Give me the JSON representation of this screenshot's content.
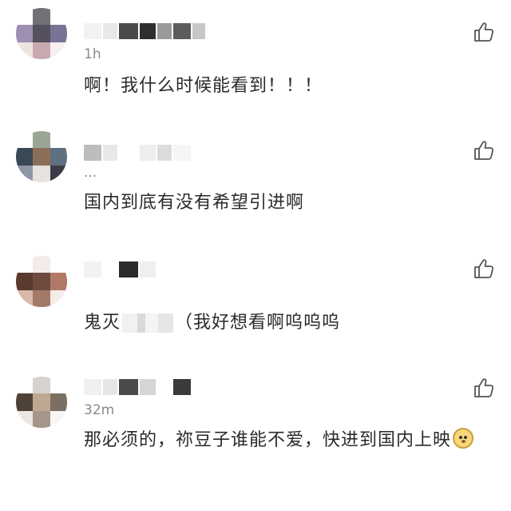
{
  "comments": [
    {
      "time": "1h",
      "text": "啊！我什么时候能看到！！！",
      "avatar_colors": [
        "#ffffff",
        "#6f7177",
        "#ffffff",
        "#9c8fb2",
        "#55505e",
        "#7a7294",
        "#efe3e0",
        "#c9a9b0",
        "#f6efef"
      ],
      "username_blocks": [
        "#f2f2f2",
        "#e9e9e9",
        "#4b4b4b",
        "#2e2e2e",
        "#9a9a9a",
        "#5c5c5c",
        "#c7c7c7"
      ]
    },
    {
      "time": "...",
      "text": "国内到底有没有希望引进啊",
      "avatar_colors": [
        "#ffffff",
        "#9ba596",
        "#ffffff",
        "#3b4955",
        "#8c6e59",
        "#5f7080",
        "#8e96a4",
        "#e6e2e0",
        "#3d3c46"
      ],
      "username_blocks": [
        "#bdbdbd",
        "#e8e8e8",
        "#ffffff",
        "#eeeeee",
        "#dcdcdc",
        "#f5f5f5"
      ]
    },
    {
      "time": "",
      "text_before": "鬼灭",
      "text_after": "（我好想看啊呜呜呜",
      "avatar_colors": [
        "#ffffff",
        "#f3ece9",
        "#ffffff",
        "#5a3a2e",
        "#6e4a3f",
        "#b07a66",
        "#d8b8a8",
        "#a37a6a",
        "#f5ebe7"
      ],
      "username_blocks": [
        "#f2f2f2",
        "#ffffff",
        "#2c2c2c",
        "#efefef"
      ]
    },
    {
      "time": "32m",
      "text": "那必须的，祢豆子谁能不爱，快进到国内上映",
      "avatar_colors": [
        "#ffffff",
        "#d7d2cd",
        "#ffffff",
        "#4e4238",
        "#bfa792",
        "#7a6f62",
        "#eae6e3",
        "#a49688",
        "#f8f6f4"
      ],
      "username_blocks": [
        "#f0f0f0",
        "#e6e6e6",
        "#4a4a4a",
        "#d5d5d5",
        "#ffffff",
        "#3a3a3a"
      ]
    }
  ],
  "icons": {
    "like": "thumbs-up-icon",
    "emoji": "dog-face-emoji-icon"
  }
}
